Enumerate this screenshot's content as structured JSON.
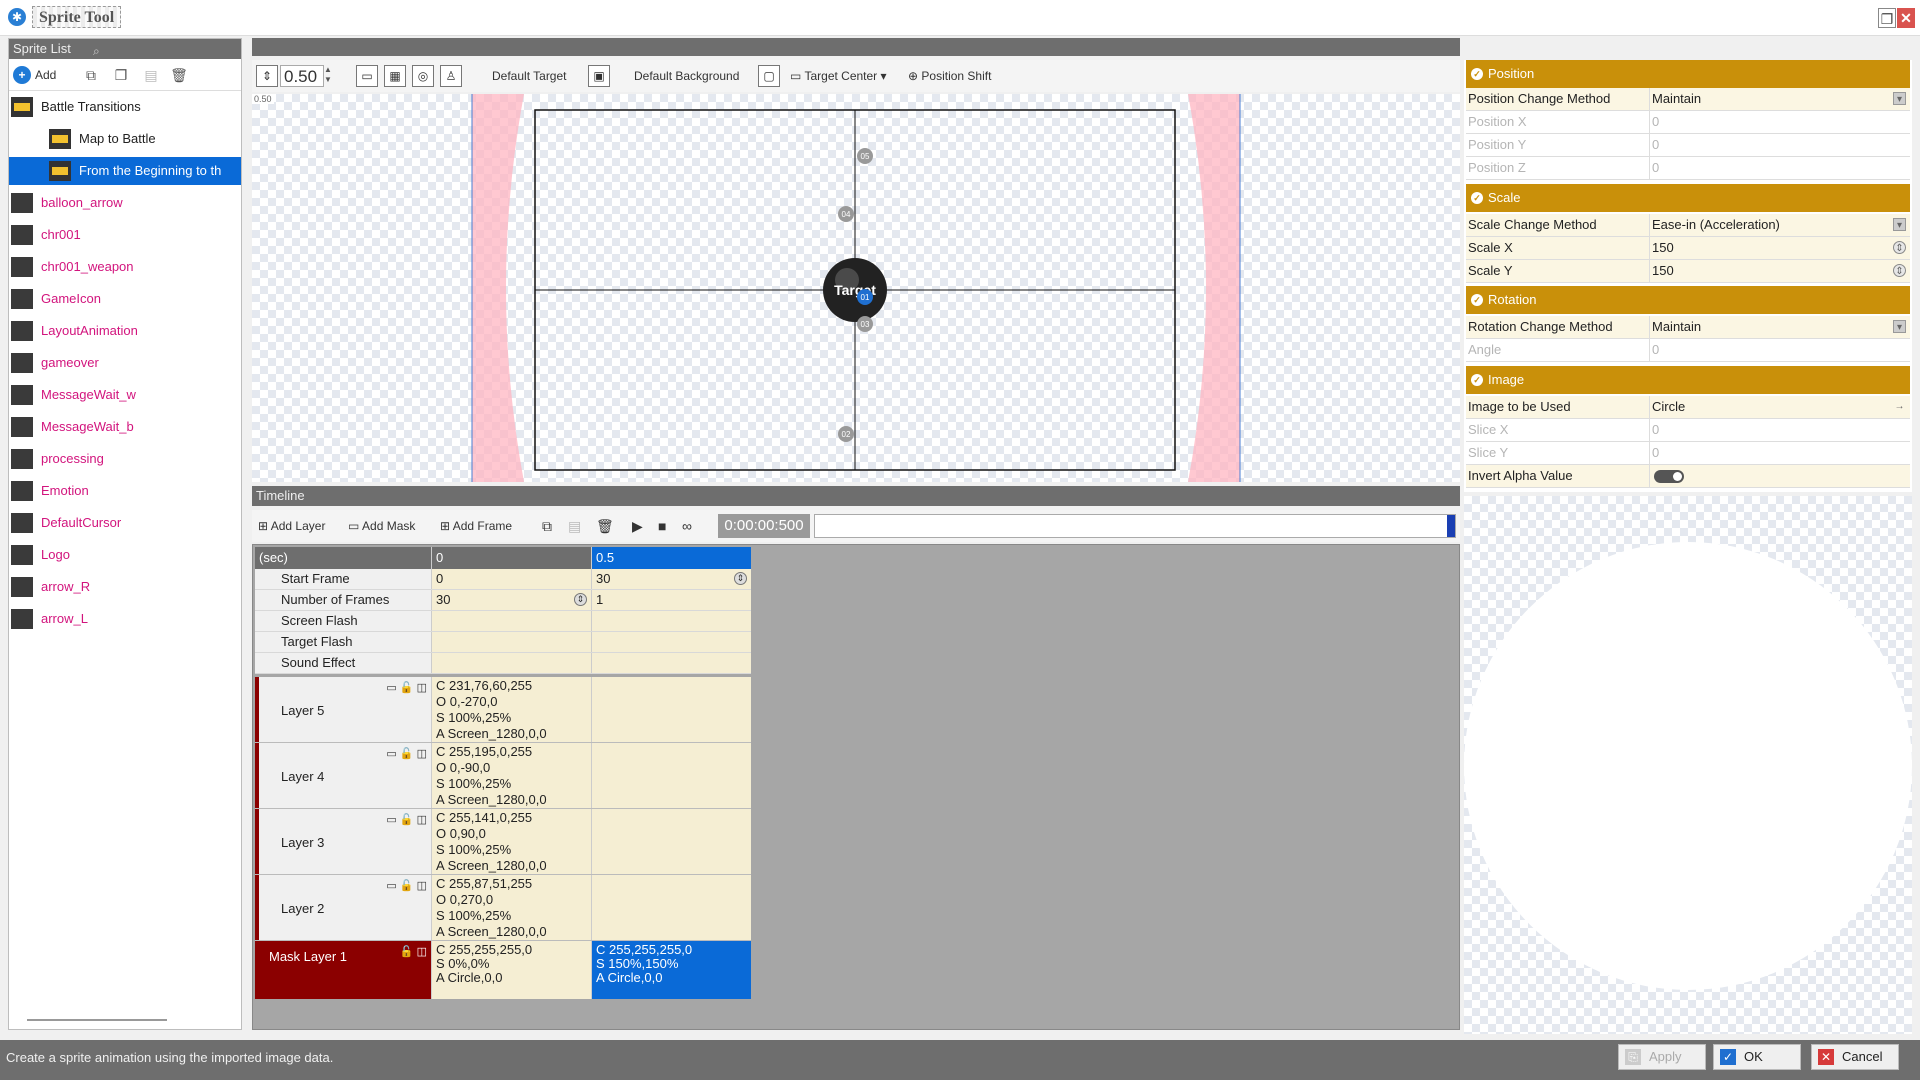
{
  "app": {
    "title": "Sprite Tool"
  },
  "sprite_list": {
    "header": "Sprite List",
    "add_label": "Add",
    "items": [
      {
        "label": "Battle Transitions",
        "kind": "folder",
        "level": 0
      },
      {
        "label": "Map to Battle",
        "kind": "folder",
        "level": 1
      },
      {
        "label": "From the Beginning to th",
        "kind": "folder",
        "level": 1,
        "selected": true
      },
      {
        "label": "balloon_arrow",
        "kind": "sprite",
        "level": 0
      },
      {
        "label": "chr001",
        "kind": "sprite",
        "level": 0
      },
      {
        "label": "chr001_weapon",
        "kind": "sprite",
        "level": 0
      },
      {
        "label": "GameIcon",
        "kind": "sprite",
        "level": 0
      },
      {
        "label": "LayoutAnimation",
        "kind": "sprite",
        "level": 0
      },
      {
        "label": "gameover",
        "kind": "sprite",
        "level": 0
      },
      {
        "label": "MessageWait_w",
        "kind": "sprite",
        "level": 0
      },
      {
        "label": "MessageWait_b",
        "kind": "sprite",
        "level": 0
      },
      {
        "label": "processing",
        "kind": "sprite",
        "level": 0
      },
      {
        "label": "Emotion",
        "kind": "sprite",
        "level": 0
      },
      {
        "label": "DefaultCursor",
        "kind": "sprite",
        "level": 0
      },
      {
        "label": "Logo",
        "kind": "sprite",
        "level": 0
      },
      {
        "label": "arrow_R",
        "kind": "sprite",
        "level": 0
      },
      {
        "label": "arrow_L",
        "kind": "sprite",
        "level": 0
      }
    ]
  },
  "view_toolbar": {
    "zoom": "0.50",
    "default_target": "Default Target",
    "default_background": "Default Background",
    "target_center": "Target Center",
    "position_shift": "Position Shift"
  },
  "viewport": {
    "corner_label": "0.50",
    "target_label": "Target",
    "markers": [
      "05",
      "04",
      "01",
      "03",
      "02"
    ]
  },
  "timeline": {
    "header": "Timeline",
    "add_layer": "Add Layer",
    "add_mask": "Add Mask",
    "add_frame": "Add Frame",
    "time": "0:00:00:500",
    "columns": [
      "(sec)",
      "0",
      "0.5"
    ],
    "props": [
      {
        "label": "Start Frame",
        "v0": "0",
        "v1": "30"
      },
      {
        "label": "Number of Frames",
        "v0": "30",
        "v1": "1"
      },
      {
        "label": "Screen Flash",
        "v0": "",
        "v1": ""
      },
      {
        "label": "Target Flash",
        "v0": "",
        "v1": ""
      },
      {
        "label": "Sound Effect",
        "v0": "",
        "v1": ""
      }
    ],
    "layers": [
      {
        "name": "Layer 5",
        "c": "C 231,76,60,255",
        "o": "O 0,-270,0",
        "s": "S 100%,25%",
        "a": "A Screen_1280,0,0"
      },
      {
        "name": "Layer 4",
        "c": "C 255,195,0,255",
        "o": "O 0,-90,0",
        "s": "S 100%,25%",
        "a": "A Screen_1280,0,0"
      },
      {
        "name": "Layer 3",
        "c": "C 255,141,0,255",
        "o": "O 0,90,0",
        "s": "S 100%,25%",
        "a": "A Screen_1280,0,0"
      },
      {
        "name": "Layer 2",
        "c": "C 255,87,51,255",
        "o": "O 0,270,0",
        "s": "S 100%,25%",
        "a": "A Screen_1280,0,0"
      }
    ],
    "mask": {
      "name": "Mask Layer 1",
      "k0": {
        "c": "C 255,255,255,0",
        "s": "S 0%,0%",
        "a": "A Circle,0,0"
      },
      "k1": {
        "c": "C 255,255,255,0",
        "s": "S 150%,150%",
        "a": "A Circle,0,0"
      }
    }
  },
  "properties": {
    "position": {
      "title": "Position",
      "method_label": "Position Change Method",
      "method_value": "Maintain",
      "x_label": "Position X",
      "x": "0",
      "y_label": "Position Y",
      "y": "0",
      "z_label": "Position Z",
      "z": "0"
    },
    "scale": {
      "title": "Scale",
      "method_label": "Scale Change Method",
      "method_value": "Ease-in (Acceleration)",
      "x_label": "Scale X",
      "x": "150",
      "y_label": "Scale Y",
      "y": "150"
    },
    "rotation": {
      "title": "Rotation",
      "method_label": "Rotation Change Method",
      "method_value": "Maintain",
      "angle_label": "Angle",
      "angle": "0"
    },
    "image": {
      "title": "Image",
      "used_label": "Image to be Used",
      "used_value": "Circle",
      "slice_x_label": "Slice X",
      "slice_x": "0",
      "slice_y_label": "Slice Y",
      "slice_y": "0",
      "invert_label": "Invert Alpha Value",
      "invert": true
    }
  },
  "status": {
    "text": "Create a sprite animation using the imported image data.",
    "apply": "Apply",
    "ok": "OK",
    "cancel": "Cancel"
  },
  "colors": {
    "section_header": "#c9900a",
    "selection": "#0a6ad7",
    "mask_layer": "#8b0000",
    "sprite_name": "#d2147d"
  }
}
